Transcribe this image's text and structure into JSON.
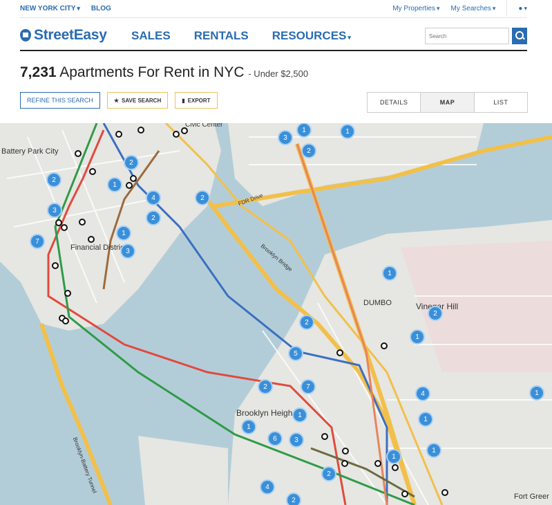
{
  "topbar": {
    "city": "NEW YORK CITY",
    "blog": "BLOG",
    "my_properties": "My Properties",
    "my_searches": "My Searches"
  },
  "nav": {
    "brand": "StreetEasy",
    "links": [
      "SALES",
      "RENTALS",
      "RESOURCES"
    ],
    "search_placeholder": "Search"
  },
  "results": {
    "count": "7,231",
    "title": "Apartments For Rent in NYC",
    "subtitle": "- Under $2,500"
  },
  "actions": {
    "refine": "REFINE THIS SEARCH",
    "save": "SAVE SEARCH",
    "export": "EXPORT"
  },
  "view_tabs": {
    "details": "DETAILS",
    "map": "MAP",
    "list": "LIST",
    "active": "MAP"
  },
  "map": {
    "labels": {
      "battery_park_city": "Battery Park City",
      "financial_district": "Financial District",
      "dumbo": "DUMBO",
      "vinegar_hill": "Vinegar Hill",
      "brooklyn_heights": "Brooklyn Heigh",
      "fort_greene": "Fort Greer",
      "civic_center": "Civic Center",
      "brooklyn_bridge": "Brooklyn Bridge",
      "fdr_drive": "FDR Drive",
      "brooklyn_battery_tunnel": "Brooklyn-Battery Tunnel"
    },
    "markers": [
      "1",
      "1",
      "3",
      "2",
      "2",
      "2",
      "1",
      "4",
      "2",
      "2",
      "3",
      "7",
      "1",
      "3",
      "1",
      "2",
      "5",
      "2",
      "7",
      "2",
      "1",
      "4",
      "1",
      "6",
      "3",
      "1",
      "1",
      "1",
      "1",
      "2",
      "4",
      "2",
      "1"
    ],
    "colors": {
      "marker": "#3a8fd9",
      "water": "#b3cdd8",
      "land": "#e6e6e2",
      "highway": "#f2c04a"
    }
  }
}
